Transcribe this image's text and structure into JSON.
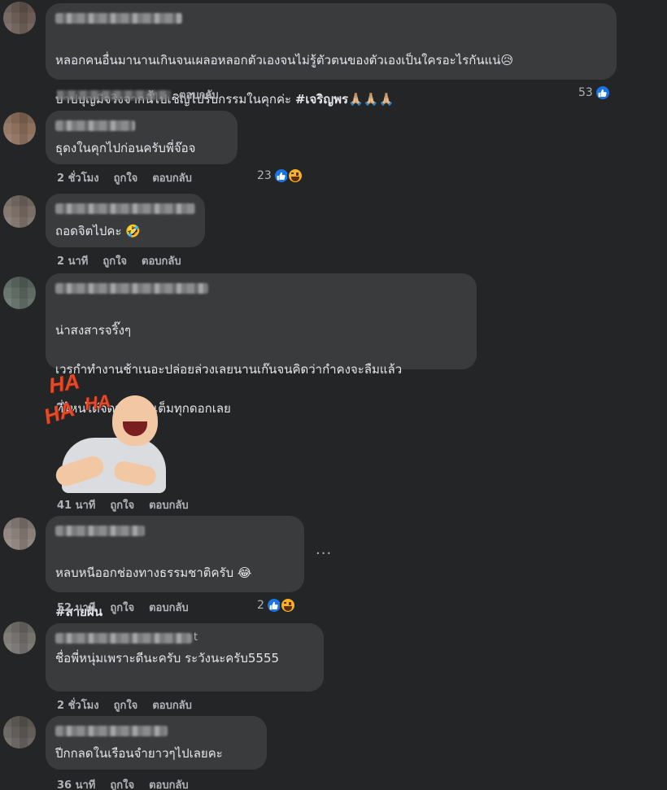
{
  "actions": {
    "like": "ถูกใจ",
    "reply": "ตอบกลับ"
  },
  "comments": [
    {
      "line1": "หลอกคนอื่นมานานเกินจนเผลอหลอกตัวเองจนไม่รู้ตัวตนของตัวเองเป็นใครอะไรกันแน่😥",
      "line2_text": "บาปบุญมีจริงจากนี้ไปเชิญไปรับกรรมในคุกค่ะ ",
      "line2_tag": "#เจริญพร",
      "line2_emoji": "🙏🏼🙏🏼🙏🏼",
      "reaction_count": "53"
    },
    {
      "text": "ธุดงในคุกไปก่อนครับพี่จ๊อจ",
      "time": "2 ชั่วโมง",
      "reaction_count": "23"
    },
    {
      "text": "ถอดจิตไปคะ ",
      "emoji": "🤣",
      "time": "2 นาที"
    },
    {
      "line1": "น่าสงสารจริ๊งๆ",
      "line2": "เวรกำทำงานช้าเนอะปล่อยล่วงเลยนานเก๊นจนคิดว่ากำคงจะลืมแล้ว",
      "line3": "ที่ไหนได้จัดหนักจัดเต็มทุกดอกเลย",
      "time": "41 นาที",
      "sticker_text": [
        "HA",
        "HA",
        "HA"
      ]
    },
    {
      "text": "หลบหนีออกช่องทางธรรมชาติครับ ",
      "emoji": "😂",
      "tag": "#สายฝัน",
      "time": "52 นาที",
      "reaction_count": "2",
      "more": "···"
    },
    {
      "name_fragment": "t",
      "text": "ชื่อพี่หนุ่มเพราะดีนะครับ ระวังนะครับ5555",
      "time": "2 ชั่วโมง"
    },
    {
      "text": "ปีกกลดในเรือนจำยาวๆไปเลยคะ",
      "time": "36 นาที"
    }
  ]
}
